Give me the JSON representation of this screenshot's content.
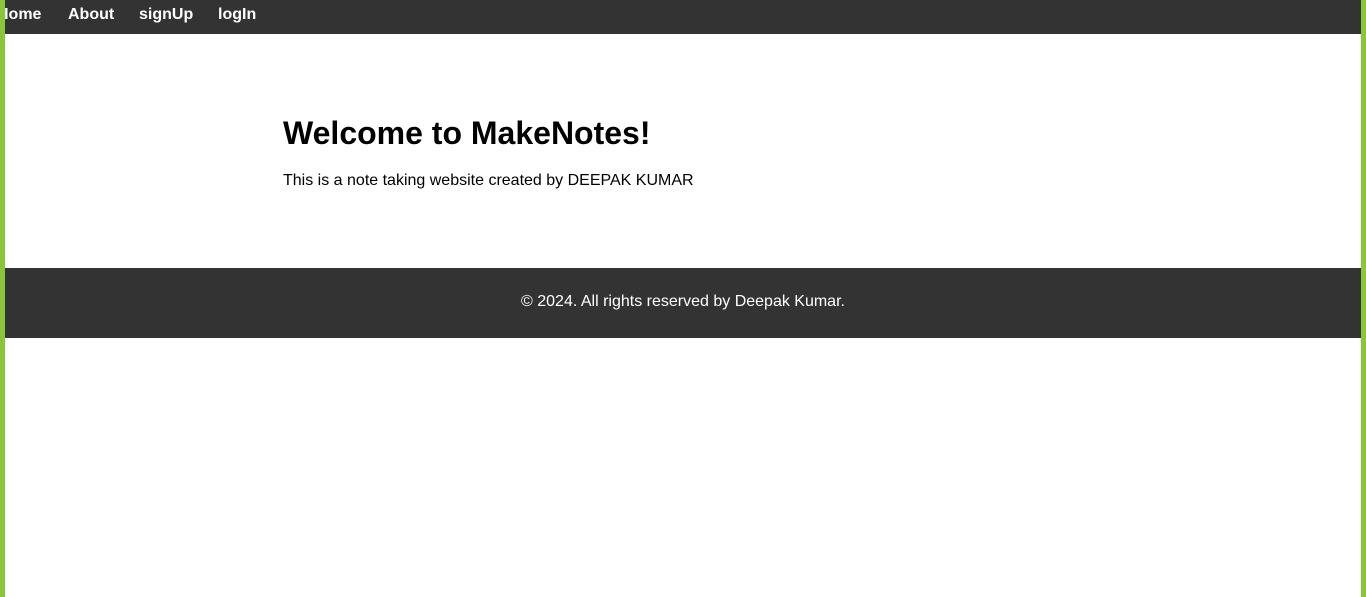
{
  "nav": {
    "items": [
      {
        "label": "Home"
      },
      {
        "label": "About"
      },
      {
        "label": "signUp"
      },
      {
        "label": "logIn"
      }
    ]
  },
  "main": {
    "title": "Welcome to MakeNotes!",
    "subtitle": "This is a note taking website created by DEEPAK KUMAR"
  },
  "footer": {
    "text": "© 2024. All rights reserved by Deepak Kumar."
  },
  "colors": {
    "nav_bg": "#333333",
    "footer_bg": "#333333",
    "edge_accent": "#8bc53a",
    "nav_text": "#ffffff",
    "body_text": "#000000"
  }
}
